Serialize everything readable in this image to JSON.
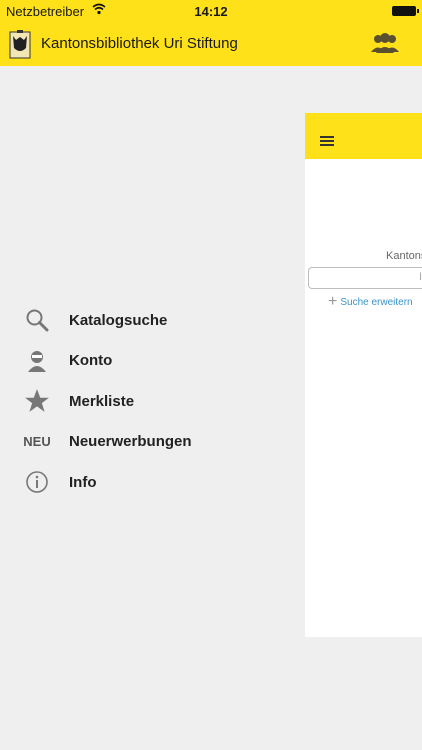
{
  "status_bar": {
    "carrier": "Netzbetreiber",
    "time": "14:12"
  },
  "header": {
    "title": "Kantonsbibliothek Uri Stiftung",
    "logo_icon": "library-logo-icon",
    "account_icon": "users-icon"
  },
  "menu": {
    "items": [
      {
        "label": "Katalogsuche",
        "icon": "search-icon"
      },
      {
        "label": "Konto",
        "icon": "user-icon"
      },
      {
        "label": "Merkliste",
        "icon": "star-icon"
      },
      {
        "label": "Neuerwerbungen",
        "icon": "new-icon",
        "icon_text": "NEU"
      },
      {
        "label": "Info",
        "icon": "info-icon"
      }
    ]
  },
  "panel": {
    "label": "Kantons",
    "input_partial": "I",
    "expand_label": "Suche erweitern"
  },
  "colors": {
    "accent": "#ffe11a",
    "background": "#efefef",
    "link": "#3a93c7"
  }
}
